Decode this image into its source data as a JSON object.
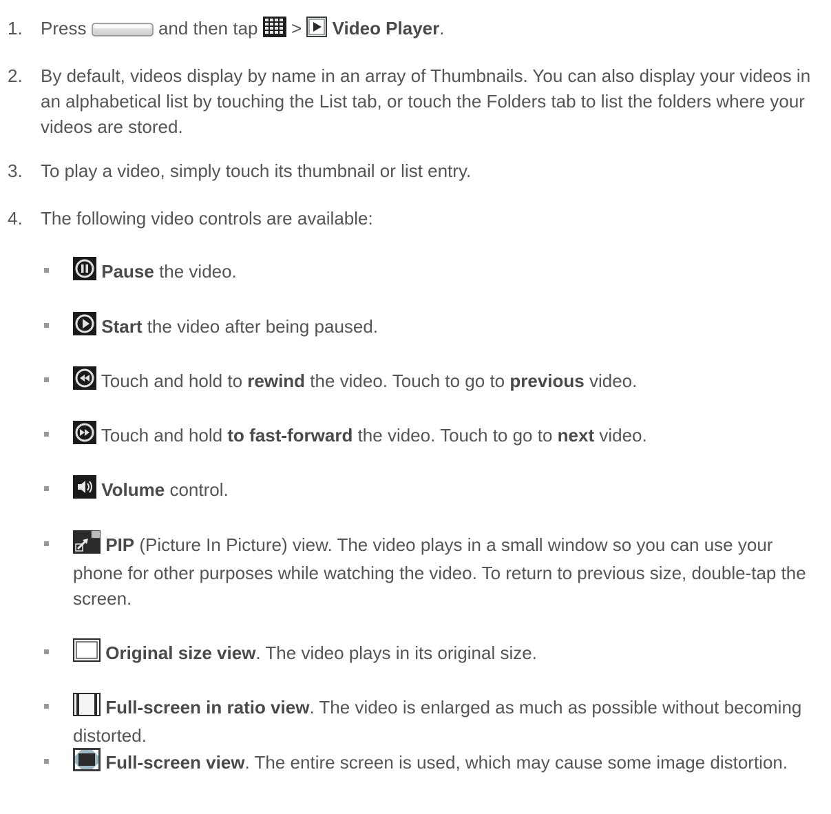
{
  "steps": [
    {
      "num": "1.",
      "text_a": "Press",
      "text_b": "and then tap",
      "text_c": ">",
      "bold": "Video Player",
      "text_d": "."
    },
    {
      "num": "2.",
      "text": "By default, videos display by name in an array of Thumbnails. You can also display your videos in an alphabetical list by touching the List tab, or touch the Folders tab to list the folders where your videos are stored."
    },
    {
      "num": "3.",
      "text": "To play a video, simply touch its thumbnail or list entry."
    },
    {
      "num": "4.",
      "text": "The following video controls are available:"
    }
  ],
  "controls": [
    {
      "icon": "pause-icon",
      "bold": "Pause",
      "text": " the video."
    },
    {
      "icon": "play-icon",
      "bold": "Start",
      "text": " the video after being paused."
    },
    {
      "icon": "rewind-icon",
      "t1": "Touch and hold to ",
      "b1": "rewind",
      "t2": " the video. Touch to go to ",
      "b2": "previous",
      "t3": " video."
    },
    {
      "icon": "fast-forward-icon",
      "t1": "Touch and hold ",
      "b1": "to fast-forward",
      "t2": " the video. Touch to go to ",
      "b2": "next",
      "t3": " video."
    },
    {
      "icon": "volume-icon",
      "bold": "Volume",
      "text": " control."
    },
    {
      "icon": "pip-icon",
      "bold": "PIP",
      "text": " (Picture In Picture) view. The video plays in a small window so you can use your phone for other purposes while watching the video. To return to previous size, double-tap the screen."
    },
    {
      "icon": "original-size-icon",
      "bold": "Original size view",
      "text": ". The video plays in its original size."
    },
    {
      "icon": "ratio-view-icon",
      "bold": "Full-screen in ratio view",
      "text": ". The video is enlarged as much as possible without becoming distorted."
    },
    {
      "icon": "full-screen-icon",
      "bold": "Full-screen view",
      "text": ". The entire screen is used, which may cause some image distortion."
    }
  ],
  "colors": {
    "text": "#555555",
    "bold_text": "#4a4a4a",
    "bullet": "#9a9a9a"
  }
}
